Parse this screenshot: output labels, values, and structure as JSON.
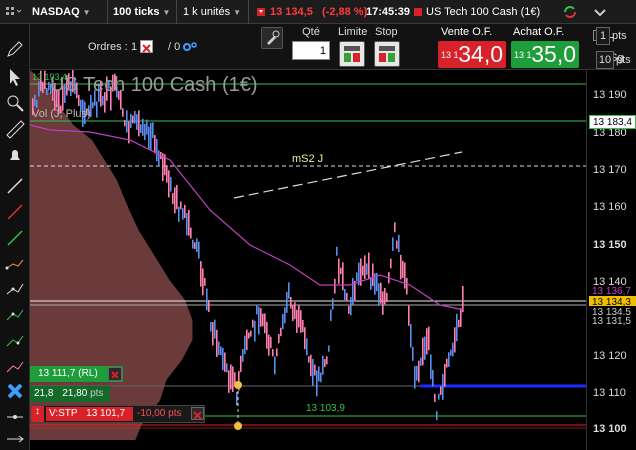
{
  "topbar": {
    "market": "NASDAQ",
    "period": "100 ticks",
    "units": "1 k unités",
    "price": "13 134,5",
    "change": "(-2,88 %)",
    "time": "17:45:39",
    "instrument": "US Tech 100 Cash (1€)"
  },
  "tradebar": {
    "orders_label": "Ordres :",
    "orders_count_1": "1",
    "orders_count_2": "/ 0",
    "qty_label": "Qté",
    "qty_value": "1",
    "limit_label": "Limite",
    "stop_label": "Stop",
    "sell_label": "Vente O.F.",
    "buy_label": "Achat O.F.",
    "sell_prefix": "13 1",
    "sell_price": "34,0",
    "buy_prefix": "13 1",
    "buy_price": "35,0",
    "l_label": "L",
    "l_value": "1",
    "pts_label": "pts",
    "sg_label": "Sg",
    "sg_value": "10",
    "sg_pts": "pts"
  },
  "chart": {
    "title": "US Tech 100 Cash (1€)",
    "top_label": "13 193,4",
    "volume_label": "Vol (J, Plus)",
    "ms2_label": "mS2 J",
    "low_label": "13 103,9",
    "position_price": "13 111,7",
    "position_type": "(RL)",
    "position_qty": "21,8",
    "position_pts": "21,80",
    "pts_unit": "pts",
    "stop_label": "V:STP",
    "stop_price": "13 101,7",
    "stop_pts": "-10,00 pts"
  },
  "axis": {
    "ticks": [
      "13 190",
      "13 180",
      "13 170",
      "13 160",
      "13 150",
      "13 140",
      "13 130",
      "13 120",
      "13 110",
      "13 100"
    ],
    "tag_resistance": "13 183,4",
    "tag_ma": "13 136,7",
    "tag_price": "13 134,3",
    "tag_ma2": "13 134,5",
    "tag_low": "13 131,5"
  },
  "colors": {
    "sell": "#d8222a",
    "buy": "#1f9d3a",
    "up": "#5b8def",
    "down": "#ff7fb0",
    "profile": "#6b3a3a",
    "ma": "#c040c0"
  }
}
